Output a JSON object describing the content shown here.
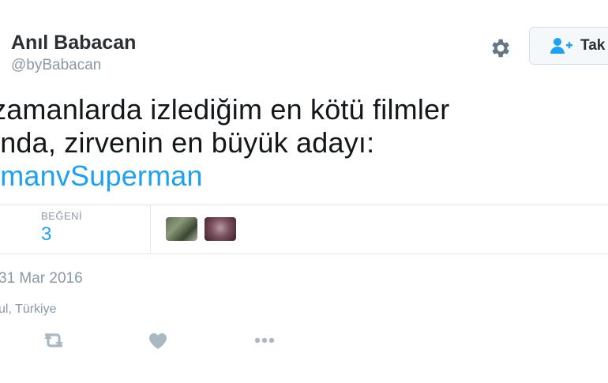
{
  "header": {
    "display_name": "Anıl Babacan",
    "handle": "@byBabacan",
    "follow_label": "Tak"
  },
  "icons": {
    "settings": "gear-icon",
    "follow": "add-user-icon",
    "retweet": "retweet-icon",
    "like": "heart-icon",
    "more": "more-dots-icon"
  },
  "tweet": {
    "lines": [
      "zamanlarda izlediğim en kötü filmler",
      "ında, zirvenin en büyük adayı:"
    ],
    "hashtag": "tmanvSuperman"
  },
  "stats": {
    "likes_label": "BEĞENİ",
    "likes_count": "3"
  },
  "meta": {
    "date": "31 Mar 2016",
    "location": "ul, Türkiye"
  },
  "colors": {
    "accent": "#1da1f2",
    "muted": "#8899a6",
    "border": "#e1e8ed",
    "text": "#14171a"
  }
}
